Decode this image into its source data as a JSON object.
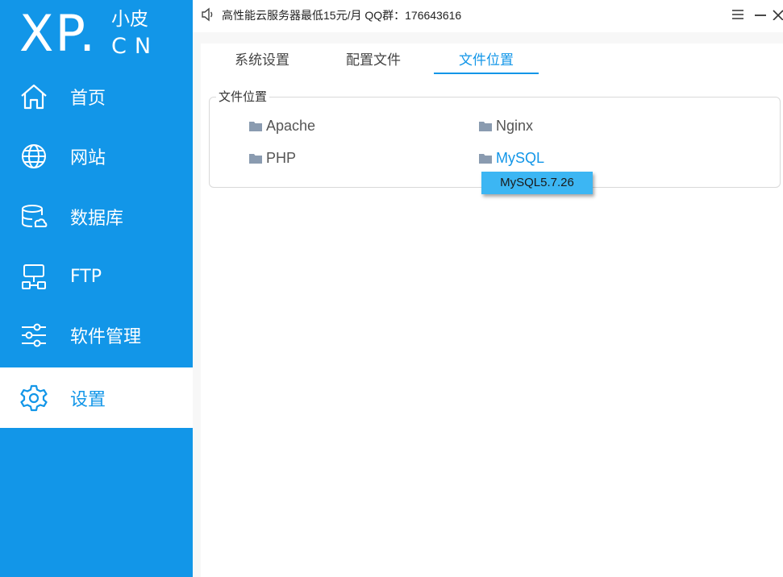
{
  "logo": {
    "main": "XP.",
    "cn_top": "小皮",
    "cn_bottom": "CN"
  },
  "sidebar": {
    "items": [
      {
        "label": "首页",
        "icon": "home-icon"
      },
      {
        "label": "网站",
        "icon": "globe-icon"
      },
      {
        "label": "数据库",
        "icon": "database-icon"
      },
      {
        "label": "FTP",
        "icon": "ftp-icon"
      },
      {
        "label": "软件管理",
        "icon": "sliders-icon"
      },
      {
        "label": "设置",
        "icon": "gear-icon",
        "active": true
      }
    ]
  },
  "topbar": {
    "notice": "高性能云服务器最低15元/月  QQ群：176643616",
    "buttons": [
      "menu-icon",
      "minimize-icon",
      "close-icon"
    ]
  },
  "tabs": [
    {
      "label": "系统设置"
    },
    {
      "label": "配置文件"
    },
    {
      "label": "文件位置",
      "active": true
    }
  ],
  "file_locations": {
    "legend": "文件位置",
    "folders": [
      {
        "label": "Apache"
      },
      {
        "label": "Nginx"
      },
      {
        "label": "PHP"
      },
      {
        "label": "MySQL",
        "hover": true
      }
    ],
    "dropdown_item": "MySQL5.7.26"
  },
  "colors": {
    "accent": "#1296e8",
    "dropdown": "#3cb6f3",
    "folder_icon": "#8a9bb0"
  }
}
